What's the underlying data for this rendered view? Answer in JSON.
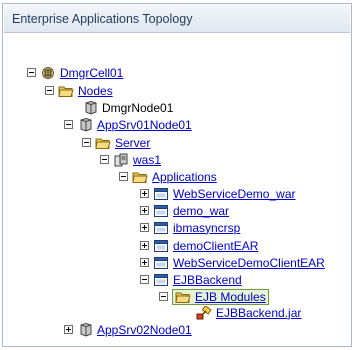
{
  "panel": {
    "title": "Enterprise Applications Topology"
  },
  "tree": {
    "cell": "DmgrCell01",
    "nodes_folder": "Nodes",
    "dmgr_node": "DmgrNode01",
    "app_node_1": "AppSrv01Node01",
    "server_folder": "Server",
    "server": "was1",
    "applications_folder": "Applications",
    "applications": [
      "WebServiceDemo_war",
      "demo_war",
      "ibmasyncrsp",
      "demoClientEAR",
      "WebServiceDemoClientEAR",
      "EJBBackend"
    ],
    "ejb_modules_folder": "EJB Modules",
    "ejb_jar": "EJBBackend.jar",
    "app_node_2": "AppSrv02Node01"
  },
  "colors": {
    "link": "#0000cc",
    "selection_bg": "#e7f3d7",
    "selection_border": "#6f9a38"
  }
}
